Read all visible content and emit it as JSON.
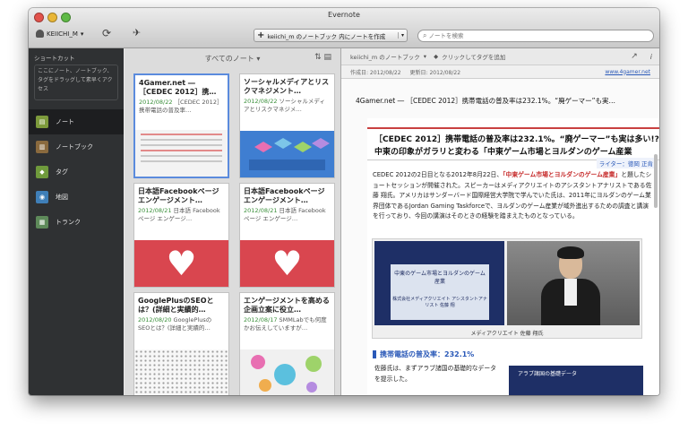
{
  "window": {
    "title": "Evernote"
  },
  "toolbar": {
    "account": "KEIICHI_M",
    "new_note_label": "keiichi_m のノートブック 内にノートを作成",
    "search_placeholder": "ノートを検索"
  },
  "sidebar": {
    "shortcuts_label": "ショートカット",
    "shortcuts_hint": "ここにノート、ノートブック、タグをドラッグして素早くアクセス",
    "items": [
      {
        "label": "ノート",
        "icon": "notes-icon"
      },
      {
        "label": "ノートブック",
        "icon": "notebook-icon"
      },
      {
        "label": "タグ",
        "icon": "tag-icon"
      },
      {
        "label": "地図",
        "icon": "map-icon"
      },
      {
        "label": "トランク",
        "icon": "trunk-icon"
      }
    ]
  },
  "notelist": {
    "header": "すべてのノート ▾",
    "notes": [
      {
        "title": "4Gamer.net ― ［CEDEC 2012］携…",
        "date": "2012/08/22",
        "snippet": "［CEDEC 2012］携帯電話の普及率…"
      },
      {
        "title": "ソーシャルメディアとリスクマネジメント…",
        "date": "2012/08/22",
        "snippet": "ソーシャルメディアとリスクマネジメ…"
      },
      {
        "title": "日本語Facebookページ エンゲージメント…",
        "date": "2012/08/21",
        "snippet": "日本語 Facebookページ エンゲージ…"
      },
      {
        "title": "日本語Facebookページ エンゲージメント…",
        "date": "2012/08/21",
        "snippet": "日本語 Facebookページ エンゲージ…"
      },
      {
        "title": "GooglePlusのSEOとは？(詳細と実績的…",
        "date": "2012/08/20",
        "snippet": "GooglePlusの SEOとは？(詳細と実績的…"
      },
      {
        "title": "エンゲージメントを高める企画立案に役立…",
        "date": "2012/08/17",
        "snippet": "SMMLabでも何度かお伝えしていますが…"
      }
    ]
  },
  "viewer": {
    "notebook": "keiichi_m のノートブック",
    "tag_hint": "クリックしてタグを追加",
    "created": "作成日: 2012/08/22",
    "updated": "更新日: 2012/08/22",
    "url": "www.4gamer.net",
    "note_title": "4Gamer.net ― ［CEDEC 2012］携帯電話の普及率は232.1%。“廃ゲーマー”も実…",
    "headline1": "［CEDEC 2012］携帯電話の普及率は232.1%。“廃ゲーマー”も実は多い!?",
    "headline2": "中東の印象がガラリと変わる「中東ゲーム市場とヨルダンのゲーム産業",
    "writer": "ライター：徳岡 正肯",
    "p1a": "CEDEC 2012の2日目となる2012年8月22日、",
    "p1b": "「中東ゲーム市場とヨルダンのゲーム産業」",
    "p1c": "と題したショートセッションが開催された。スピーカーはメディアクリエイトのアシスタントアナリストである佐藤 翔氏。アメリカはサンダーバード国際経営大学院で学んでいた氏は、2011年にヨルダンのゲーム業界団体であるJordan Gaming Taskforceで、ヨルダンのゲーム産業が域外進出するための調査と講演を行っており、今回の講演はそのときの経験を踏まえたものとなっている。",
    "slide_title": "中東のゲーム市場とヨルダンのゲーム産業",
    "slide_sub": "株式会社メディアクリエイト アシスタントアナリスト 佐藤 翔",
    "caption": "メディアクリエイト 佐藤 翔氏",
    "section": "携帯電話の普及率：232.1%",
    "p2": "佐藤氏は、まずアラブ諸国の基礎的なデータを提示した。",
    "slide2": "アラブ諸国の基礎データ"
  }
}
